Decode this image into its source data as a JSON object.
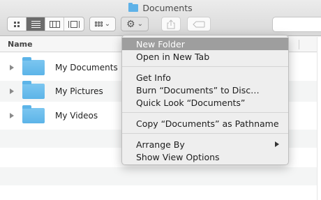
{
  "window": {
    "title": "Documents"
  },
  "toolbar": {
    "view_modes": [
      "icon-view",
      "list-view",
      "column-view",
      "cover-flow-view"
    ],
    "active_view": "list-view",
    "arrange_icon": "arrange-grid-icon",
    "action_icon": "gear-icon",
    "share_icon": "share-icon",
    "tag_icon": "tag-icon"
  },
  "header": {
    "name_label": "Name"
  },
  "files": [
    {
      "name": "My Documents"
    },
    {
      "name": "My Pictures"
    },
    {
      "name": "My Videos"
    }
  ],
  "context_menu": {
    "items": [
      "New Folder",
      "Open in New Tab",
      "Get Info",
      "Burn “Documents” to Disc…",
      "Quick Look “Documents”",
      "Copy “Documents” as Pathname",
      "Arrange By",
      "Show View Options"
    ],
    "highlighted": "New Folder"
  },
  "colors": {
    "folder": "#5cb4e8",
    "highlight": "#9e9e9e"
  }
}
